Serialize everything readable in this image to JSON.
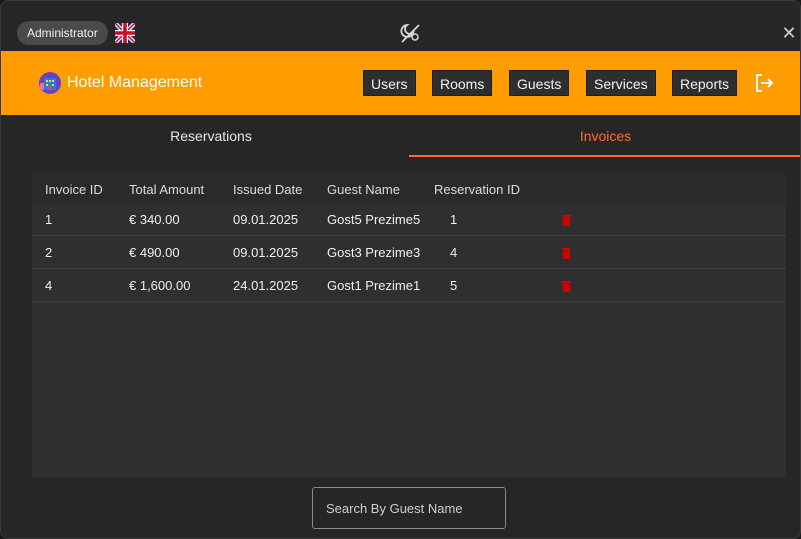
{
  "titlebar": {
    "role": "Administrator",
    "close_glyph": "✕",
    "icons": {
      "flag": "uk-flag-icon",
      "theme": "theme-toggle-icon",
      "close": "close-icon"
    }
  },
  "header": {
    "app_title": "Hotel Management",
    "nav": [
      "Users",
      "Rooms",
      "Guests",
      "Services",
      "Reports"
    ],
    "icons": {
      "logo": "hotel-logo-icon",
      "logout": "logout-icon"
    }
  },
  "tabs": [
    {
      "label": "Reservations",
      "active": false
    },
    {
      "label": "Invoices",
      "active": true
    }
  ],
  "table": {
    "columns": [
      "Invoice ID",
      "Total Amount",
      "Issued Date",
      "Guest Name",
      "Reservation ID"
    ],
    "rows": [
      {
        "invoice_id": "1",
        "total_amount": "€ 340.00",
        "issued_date": "09.01.2025",
        "guest_name": "Gost5 Prezime5",
        "reservation_id": "1"
      },
      {
        "invoice_id": "2",
        "total_amount": "€ 490.00",
        "issued_date": "09.01.2025",
        "guest_name": "Gost3 Prezime3",
        "reservation_id": "4"
      },
      {
        "invoice_id": "4",
        "total_amount": "€ 1,600.00",
        "issued_date": "24.01.2025",
        "guest_name": "Gost1 Prezime1",
        "reservation_id": "5"
      }
    ],
    "row_action_icon": "trash-icon"
  },
  "search": {
    "placeholder": "Search By Guest Name",
    "value": ""
  },
  "colors": {
    "accent": "#ff9d00",
    "active_tab": "#ff6a2a",
    "background": "#262626",
    "delete": "#d40000"
  }
}
